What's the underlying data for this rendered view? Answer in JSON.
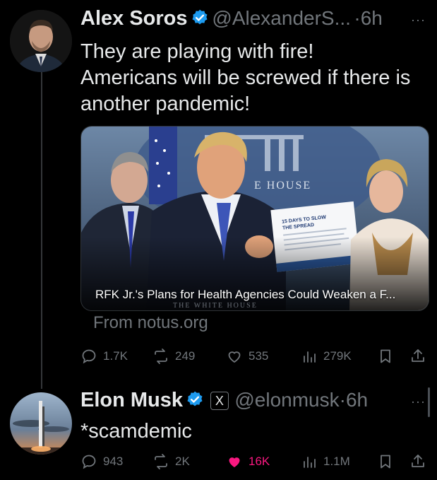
{
  "tweet1": {
    "name": "Alex Soros",
    "handle": "@AlexanderS...",
    "time": "6h",
    "text_lines": [
      "They are playing with fire!",
      "Americans will be screwed if there is",
      "another pandemic!"
    ],
    "card": {
      "headline": "RFK Jr.'s Plans for Health Agencies Could Weaken a F...",
      "source": "From notus.org",
      "backdrop_text": "THE WHITE HOUSE",
      "sign_text": "15 DAYS TO SLOW THE SPREAD"
    },
    "stats": {
      "replies": "1.7K",
      "reposts": "249",
      "likes": "535",
      "views": "279K"
    }
  },
  "tweet2": {
    "name": "Elon Musk",
    "handle": "@elonmusk",
    "time": "6h",
    "badge_letter": "X",
    "text": "*scamdemic",
    "stats": {
      "replies": "943",
      "reposts": "2K",
      "likes": "16K",
      "views": "1.1M"
    }
  },
  "colors": {
    "verified": "#1d9bf0",
    "liked": "#f91880",
    "muted": "#71767b"
  }
}
